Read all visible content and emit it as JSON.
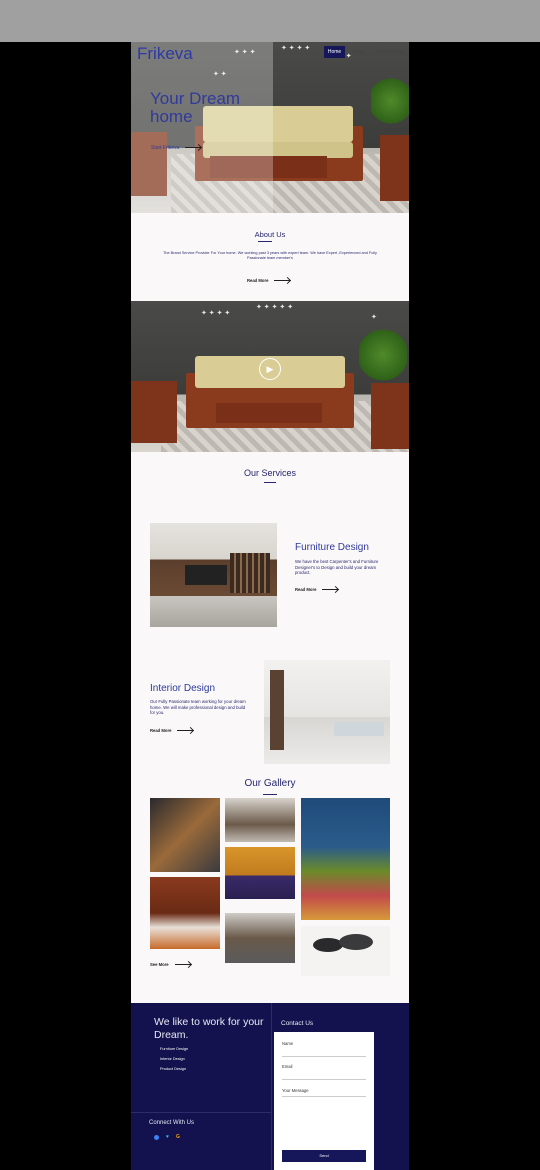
{
  "brand": {
    "name": "Frikeva"
  },
  "nav": {
    "items": [
      {
        "label": "Home"
      },
      {
        "label": "Blog"
      },
      {
        "label": "How Frikeva"
      }
    ]
  },
  "hero": {
    "title": "Your Dream home",
    "link": "Start Frikeva"
  },
  "about": {
    "title": "About Us",
    "text": "The Brand Service Provider For Your home. We working past 3 years with expert team. We have Expert ,Experienced and Fully Passionate team member's",
    "readmore": "Read More"
  },
  "services": {
    "title": "Our Services",
    "items": [
      {
        "title": "Furniture Design",
        "text": "We have the best Carpenter's and Furniture Designer's to Design and build your dream product.",
        "readmore": "Read More"
      },
      {
        "title": "Interior Design",
        "text": "Our Fully Passionate team working for your dream home. We will make professional design and build for you.",
        "readmore": "Read More"
      }
    ]
  },
  "gallery": {
    "title": "Our Gallery",
    "see_more": "See More"
  },
  "footer": {
    "title": "We like to work for your Dream.",
    "links": [
      "Furniture Design",
      "Interior Design",
      "Product Design"
    ],
    "connect": "Connect With Us",
    "social_icons": [
      "facebook-icon",
      "twitter-icon",
      "google-icon"
    ]
  },
  "contact": {
    "title": "Contact Us",
    "name_label": "Name",
    "email_label": "Email",
    "message_label": "Your Message",
    "send_label": "Send"
  },
  "colors": {
    "accent": "#27276e",
    "footer_bg": "#13124e",
    "nav_active": "#16175a"
  }
}
